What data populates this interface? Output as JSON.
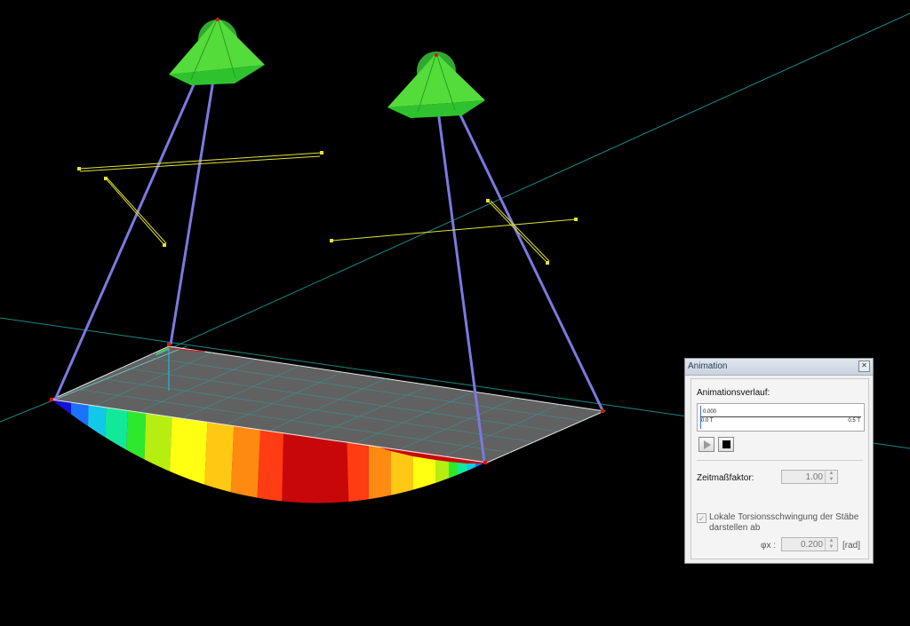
{
  "animation_panel": {
    "title": "Animation",
    "close_icon": "close-icon",
    "history_label": "Animationsverlauf:",
    "history_value": "0.000",
    "history_start": "0.0 T",
    "history_end": "0.5 T",
    "play_icon": "play-icon",
    "stop_icon": "stop-icon",
    "time_scale_label": "Zeitmaßfaktor:",
    "time_scale_value": "1.00",
    "torsion_checkbox_checked": true,
    "torsion_label_line1": "Lokale Torsionsschwingung der Stäbe",
    "torsion_label_line2": "darstellen ab",
    "phi_label": "φx :",
    "phi_value": "0.200",
    "phi_unit": "[rad]"
  },
  "viewport": {
    "background": "#000000",
    "axis_color": "#1a8a86",
    "cable_color": "#7a7ae0",
    "support_color": "#39c739",
    "member_color": "#e2e237",
    "slab_grid_color": "#2aa6a6",
    "contour_colors": [
      "#1212d8",
      "#1a72ff",
      "#12c8e8",
      "#12e89a",
      "#2ee82e",
      "#b6ee12",
      "#ffff12",
      "#ffc812",
      "#ff8a12",
      "#ff3c12",
      "#e01010",
      "#c80808"
    ]
  }
}
